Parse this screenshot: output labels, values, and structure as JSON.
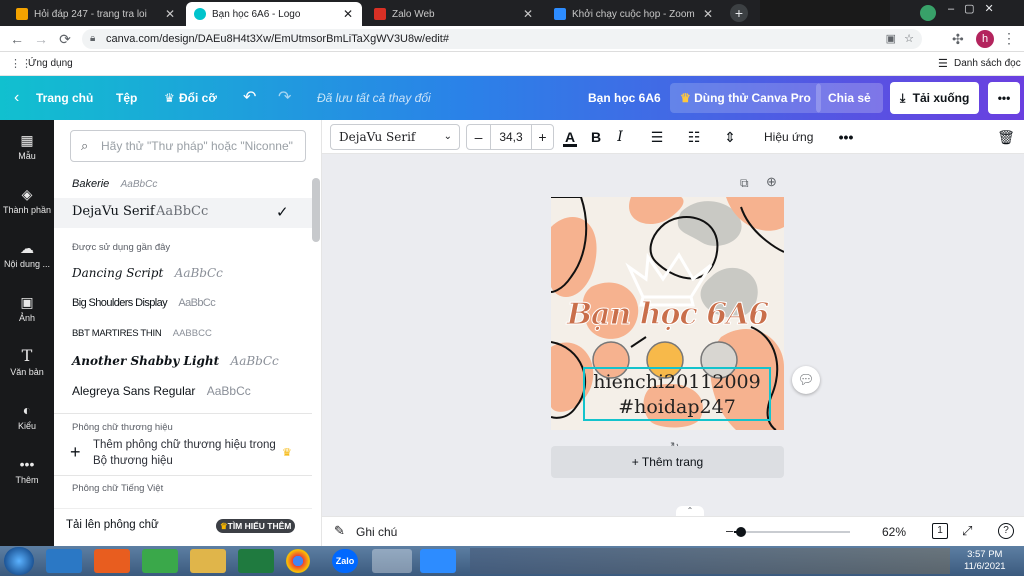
{
  "browser": {
    "tabs": [
      {
        "title": "Hỏi đáp 247 - trang tra loi",
        "favicon_color": "#f4a300"
      },
      {
        "title": "Bạn học 6A6 - Logo",
        "favicon_color": "#00c4cc"
      },
      {
        "title": "Zalo Web",
        "favicon_color": "#d93025"
      },
      {
        "title": "Khởi chạy cuộc họp - Zoom",
        "favicon_color": "#2d8cff"
      }
    ],
    "url": "canva.com/design/DAEu8H4t3Xw/EmUtmsorBmLiTaXgWV3U8w/edit#",
    "bookmarks_apps": "Ứng dụng",
    "reading_list": "Danh sách đọc",
    "profile_initial": "h"
  },
  "header": {
    "home": "Trang chủ",
    "file": "Tệp",
    "resize": "Đổi cỡ",
    "saved_status": "Đã lưu tất cả thay đổi",
    "title": "Bạn học 6A6",
    "try_pro": "Dùng thử Canva Pro",
    "share": "Chia sẻ",
    "download": "Tải xuống"
  },
  "rail": [
    {
      "label": "Mẫu",
      "icon": "template-icon"
    },
    {
      "label": "Thành phần",
      "icon": "elements-icon"
    },
    {
      "label": "Nội dung ...",
      "icon": "uploads-icon"
    },
    {
      "label": "Ảnh",
      "icon": "photos-icon"
    },
    {
      "label": "Văn bản",
      "icon": "text-icon"
    },
    {
      "label": "Kiểu",
      "icon": "styles-icon"
    },
    {
      "label": "Thêm",
      "icon": "more-icon"
    }
  ],
  "fontpanel": {
    "search_placeholder": "Hãy thử \"Thư pháp\" hoặc \"Niconne\"",
    "top_font": {
      "name": "Bakerie",
      "sample": "AaBbCc"
    },
    "selected_font": {
      "name": "DejaVu Serif",
      "sample": "AaBbCc"
    },
    "recent_heading": "Được sử dụng gần đây",
    "recent": [
      {
        "name": "Dancing Script",
        "sample": "AaBbCc"
      },
      {
        "name": "Big Shoulders Display",
        "sample": "AaBbCc"
      },
      {
        "name": "BBT MARTIRES THIN",
        "sample": "AABBCC"
      },
      {
        "name": "Another Shabby Light",
        "sample": "AaBbCc"
      },
      {
        "name": "Alegreya Sans Regular",
        "sample": "AaBbCc"
      }
    ],
    "brand_heading": "Phông chữ thương hiệu",
    "brand_add": "Thêm phông chữ thương hiệu trong Bộ thương hiệu",
    "vn_heading": "Phông chữ Tiếng Việt",
    "upload": "Tải lên phông chữ",
    "learn_more": "TÌM HIỂU THÊM"
  },
  "toolbar": {
    "font": "DejaVu Serif",
    "size": "34,3",
    "effects": "Hiệu ứng"
  },
  "design": {
    "title_text": "Bạn học 6A6",
    "line1": "hienchi20112009",
    "line2": "#hoidap247",
    "add_page": "+ Thêm trang"
  },
  "bottom": {
    "notes": "Ghi chú",
    "zoom": "62%",
    "zoom_level": 0.62,
    "page_num": "1"
  },
  "taskbar": {
    "time": "3:57 PM",
    "date": "11/6/2021",
    "zalo": "Zalo"
  }
}
